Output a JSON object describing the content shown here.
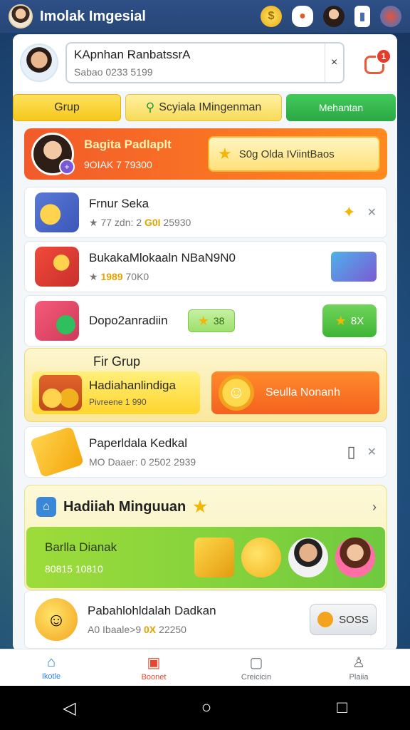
{
  "status_bar": {
    "title": "Imolak Imgesial"
  },
  "profile": {
    "name": "KApnhan RanbatssrA",
    "id_text": "Sabao 0233 5199",
    "close_label": "×",
    "notif_count": "1"
  },
  "tabs": [
    {
      "label": "Grup"
    },
    {
      "label": "Scyiala IMingenman"
    },
    {
      "label": "Mehantan"
    }
  ],
  "banner": {
    "title": "Bagita Padlaplt",
    "subtitle": "9OIAK 7 79300",
    "button_label": "S0g Olda IViintBaos"
  },
  "rows": [
    {
      "title": "Frnur Seka",
      "sub_prefix": "★ 77 zdn: 2 ",
      "sub_highlight": "G0I",
      "sub_suffix": " 25930"
    },
    {
      "title": "BukakaMlokaaln NBaN9N0",
      "sub_prefix": "★ ",
      "sub_highlight": "1989",
      "sub_suffix": " 70K0"
    },
    {
      "title": "Dopo2anradiin",
      "pill_value": "38",
      "button_label": "8X"
    }
  ],
  "fir_grup": {
    "title": "Fir Grup",
    "card_title": "Hadiahanlindiga",
    "card_sub": "Pivreene 1 990",
    "button_label": "Seulla Nonanh"
  },
  "pager_row": {
    "title": "Paperldala Kedkal",
    "sub": "MO Daaer: 0 2502 2939"
  },
  "weekly": {
    "title": "Hadiiah Minguuan",
    "card_title": "Barlla Dianak",
    "card_sub": "80815 10810"
  },
  "last_row": {
    "title": "Pabahlohldalah Dadkan",
    "sub_prefix": "A0 Ibaale>9 ",
    "sub_highlight": "0X",
    "sub_suffix": " 22250",
    "button_label": "SOSS"
  },
  "bottom_nav": [
    {
      "label": "Ikotle"
    },
    {
      "label": "Boonet"
    },
    {
      "label": "Creicicin"
    },
    {
      "label": "Plaiia"
    }
  ]
}
